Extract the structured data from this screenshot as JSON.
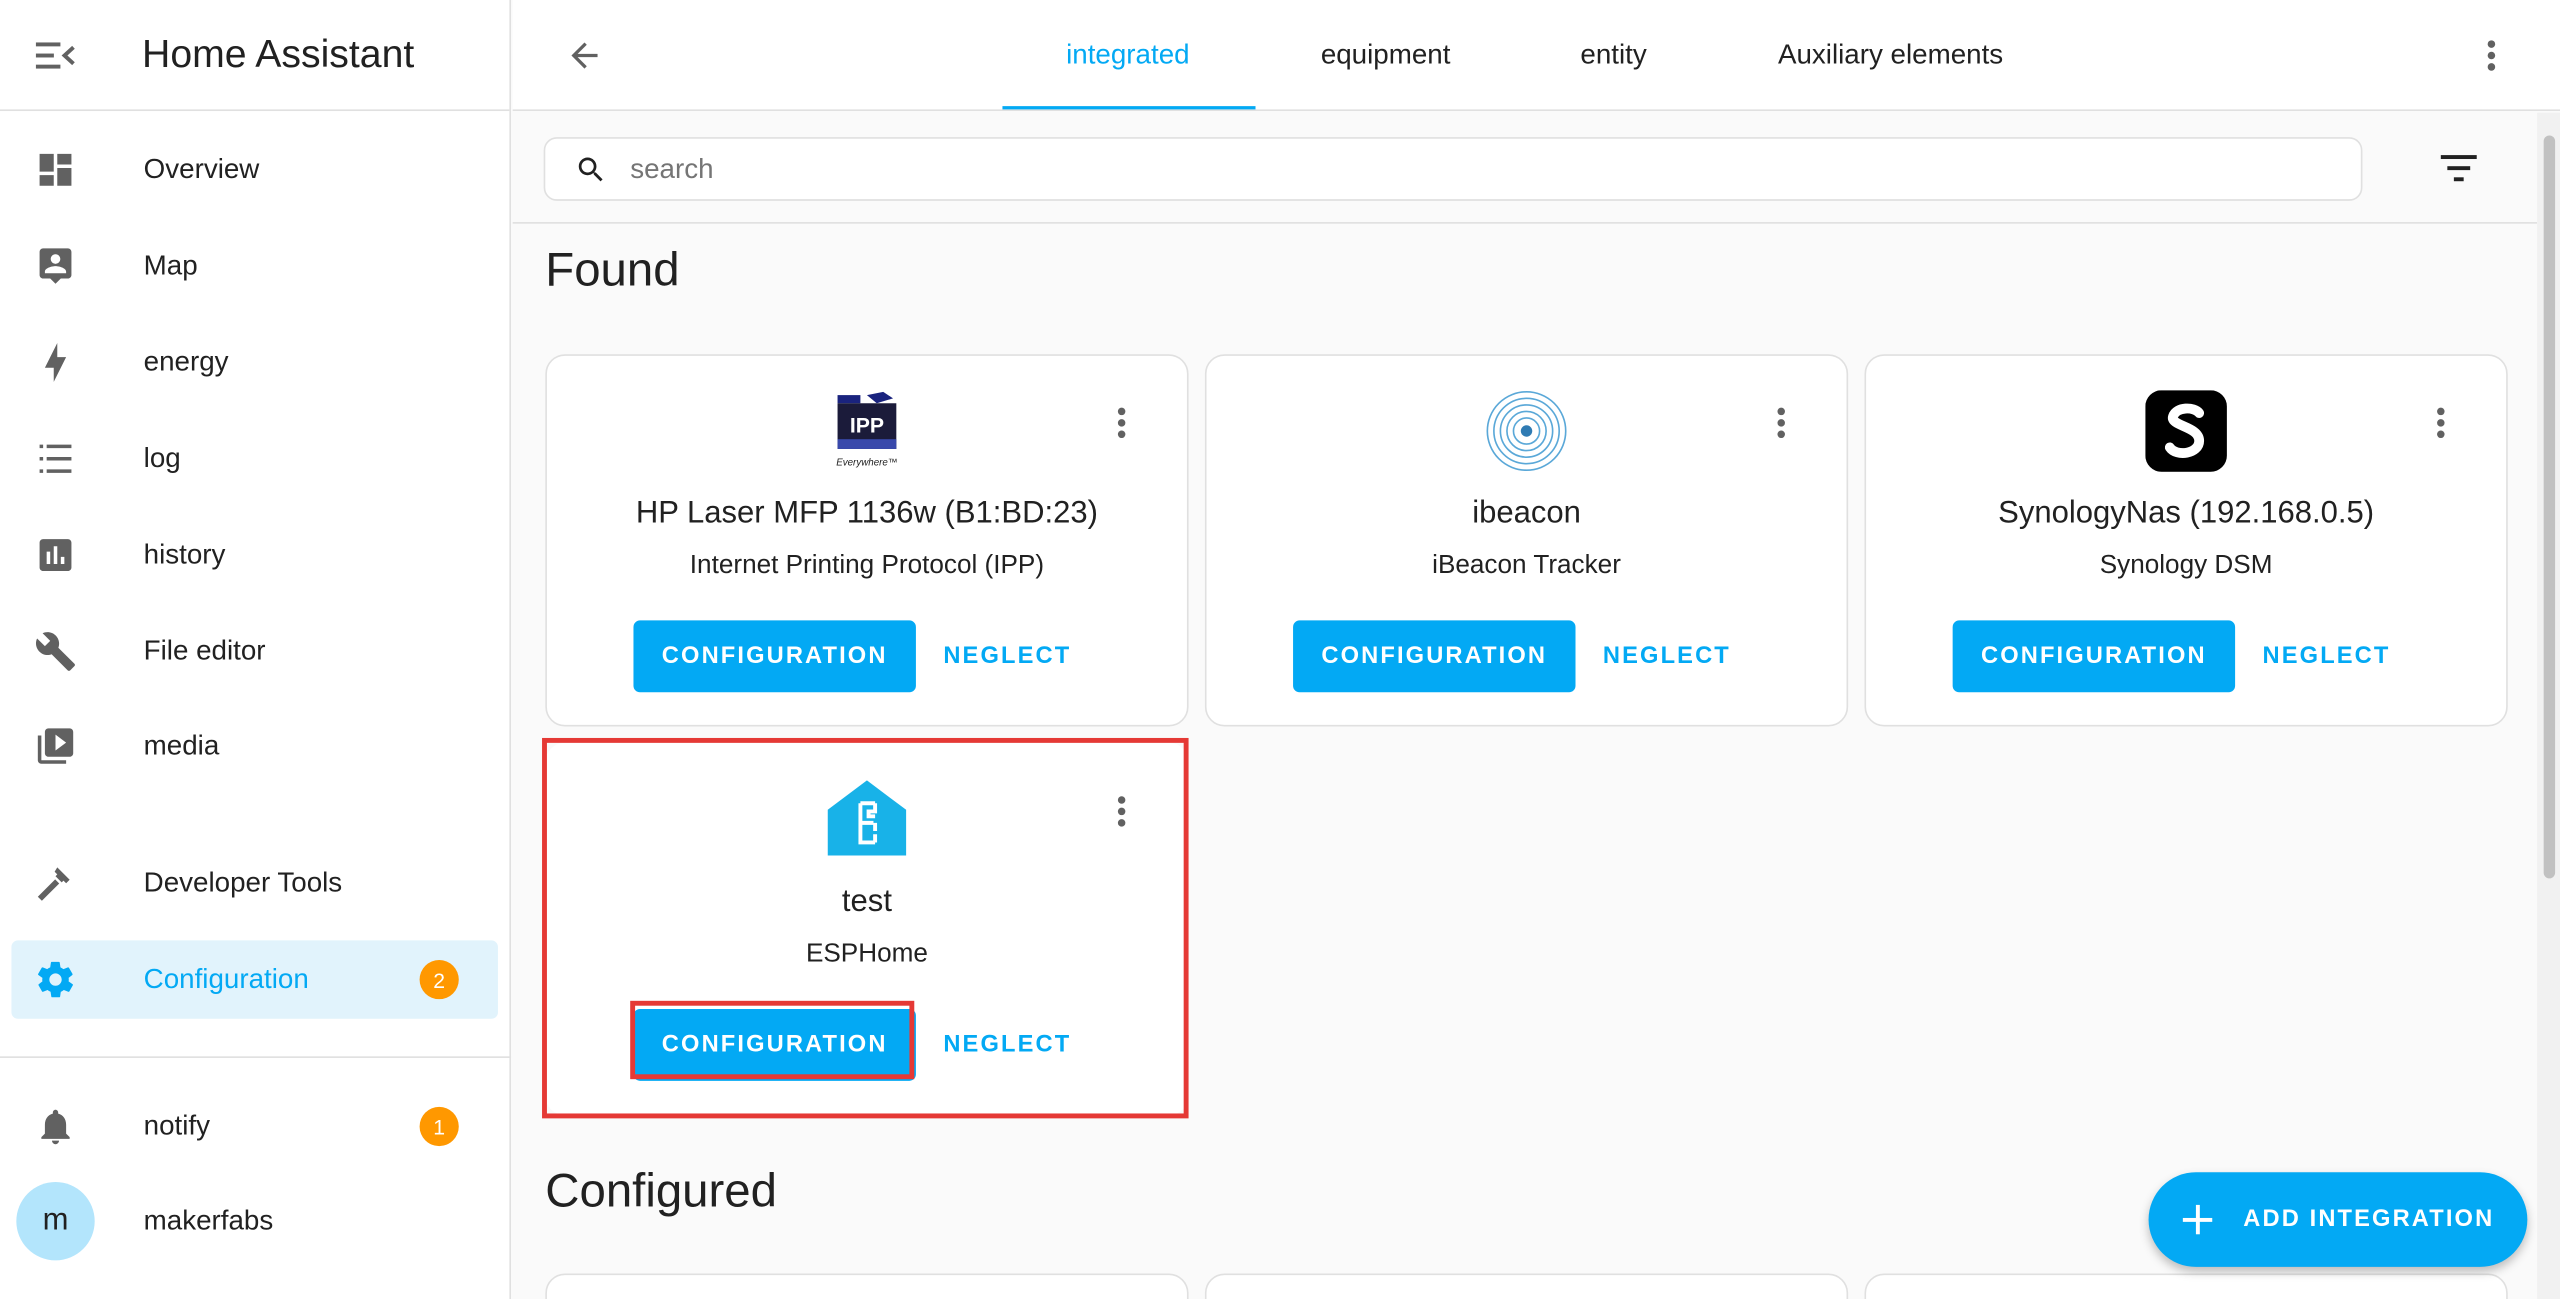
{
  "app": {
    "title": "Home Assistant"
  },
  "sidebar": {
    "items": [
      {
        "label": "Overview",
        "icon": "dashboard-icon"
      },
      {
        "label": "Map",
        "icon": "account-box-icon"
      },
      {
        "label": "energy",
        "icon": "lightning-icon"
      },
      {
        "label": "log",
        "icon": "list-icon"
      },
      {
        "label": "history",
        "icon": "chart-box-icon"
      },
      {
        "label": "File editor",
        "icon": "wrench-icon"
      },
      {
        "label": "media",
        "icon": "play-box-multiple-icon"
      },
      {
        "label": "Developer Tools",
        "icon": "hammer-icon"
      },
      {
        "label": "Configuration",
        "icon": "gear-icon",
        "badge": "2",
        "active": true
      }
    ],
    "notify": {
      "label": "notify",
      "badge": "1"
    },
    "user": {
      "label": "makerfabs",
      "initial": "m"
    }
  },
  "tabs": [
    {
      "label": "integrated",
      "active": true
    },
    {
      "label": "equipment"
    },
    {
      "label": "entity"
    },
    {
      "label": "Auxiliary elements"
    }
  ],
  "search": {
    "placeholder": "search",
    "value": ""
  },
  "sections": {
    "found": "Found",
    "configured": "Configured"
  },
  "cards": [
    {
      "title": "HP Laser MFP 1136w (B1:BD:23)",
      "subtitle": "Internet Printing Protocol (IPP)",
      "logo": "ipp-logo",
      "logo_text": "IPP",
      "logo_subtext": "Everywhere™",
      "config_label": "CONFIGURATION",
      "neglect_label": "NEGLECT"
    },
    {
      "title": "ibeacon",
      "subtitle": "iBeacon Tracker",
      "logo": "ibeacon-logo",
      "config_label": "CONFIGURATION",
      "neglect_label": "NEGLECT"
    },
    {
      "title": "SynologyNas (192.168.0.5)",
      "subtitle": "Synology DSM",
      "logo": "synology-logo",
      "config_label": "CONFIGURATION",
      "neglect_label": "NEGLECT"
    },
    {
      "title": "test",
      "subtitle": "ESPHome",
      "logo": "esphome-logo",
      "config_label": "CONFIGURATION",
      "neglect_label": "NEGLECT",
      "highlighted": true
    }
  ],
  "fab": {
    "label": "ADD INTEGRATION"
  },
  "colors": {
    "accent": "#03a9f4",
    "badge": "#ff9800",
    "highlight": "#e53935",
    "active_bg": "#e1f3fc"
  }
}
